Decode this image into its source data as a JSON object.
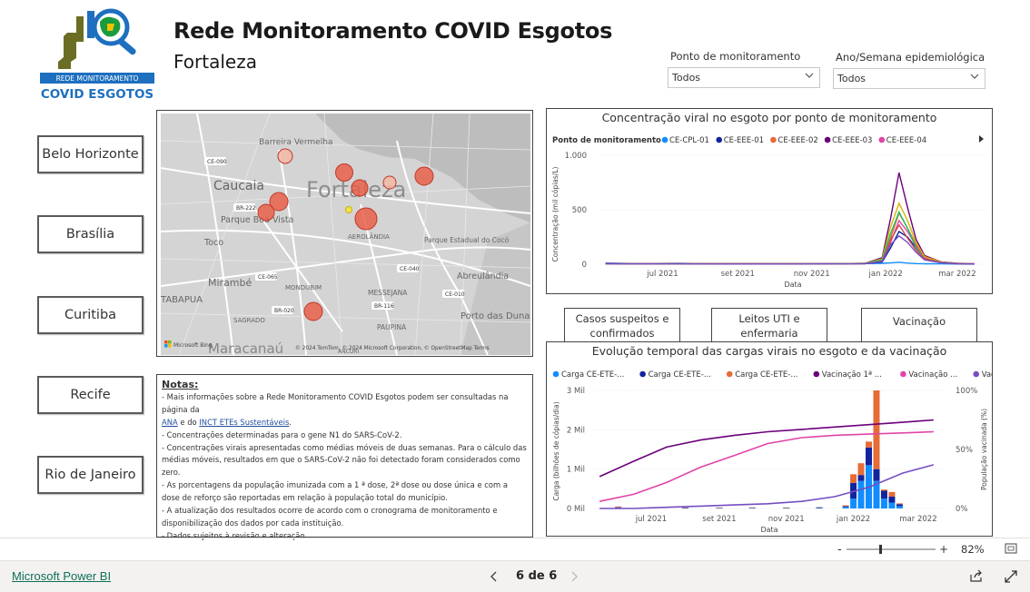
{
  "header": {
    "title": "Rede Monitoramento COVID Esgotos",
    "subtitle": "Fortaleza",
    "logo_line1": "REDE MONITORAMENTO",
    "logo_line2": "COVID ESGOTOS"
  },
  "filters": {
    "ponto": {
      "label": "Ponto de monitoramento",
      "value": "Todos"
    },
    "semana": {
      "label": "Ano/Semana epidemiológica",
      "value": "Todos"
    }
  },
  "cities": [
    "Belo Horizonte",
    "Brasília",
    "Curitiba",
    "Recife",
    "Rio de Janeiro"
  ],
  "map": {
    "labels": {
      "barreira": "Barreira Vermelha",
      "caucaia": "Caucaia",
      "fortaleza": "Fortaleza",
      "parque": "Parque Boa Vista",
      "toco": "Toco",
      "mirambe": "Mirambé",
      "maracanau": "Maracanaú",
      "aerolandia": "AEROLÂNDIA",
      "parque_estadual": "Parque Estadual do Cocó",
      "abreulandia": "Abreulândia",
      "porto": "Porto das Dunas",
      "messejana": "MESSEJANA",
      "paupina": "PAUPINA",
      "mondubim": "MONDUBIM",
      "sagrado": "SAGRADO",
      "tabapua": "TABAPUA",
      "ancuri": "ANCURI"
    },
    "roads": [
      "CE-090",
      "BR-222",
      "CE-065",
      "BR-020",
      "CE-040",
      "CE-010",
      "BR-116"
    ],
    "attribution": "© 2024 TomTom, © 2024 Microsoft Corporation, © OpenStreetMap  Terms",
    "ms_logo": "Microsoft Bing"
  },
  "notes": {
    "title": "Notas:",
    "l1a": "- Mais informações sobre a Rede Monitoramento COVID Esgotos podem ser consultadas na página da",
    "l1b_pre": "",
    "l1b_link1": "ANA",
    "l1b_mid": " e do ",
    "l1b_link2": "INCT ETEs Sustentáveis",
    "l1b_post": ".",
    "l2": "- Concentrações determinadas para o gene N1 do SARS-CoV-2.",
    "l3": "- Concentrações virais apresentadas como médias móveis de duas semanas. Para o cálculo das médias móveis, resultados em que o SARS-CoV-2 não foi detectado foram considerados como zero.",
    "l4": "- As porcentagens da população imunizada com a 1 ª dose, 2ª dose ou dose única e com a dose de reforço são reportadas em relação à população total do município.",
    "l5": "- A atualização dos resultados ocorre de acordo com o cronograma de monitoramento e disponibilização dos dados por cada instituição.",
    "l6": "- Dados sujeitos à revisão e alteração."
  },
  "chart1": {
    "title": "Concentração viral no esgoto por ponto de monitoramento",
    "legend_title": "Ponto de monitoramento",
    "ylabel": "Concentração (mil cópias/L)",
    "xlabel": "Data",
    "yticks": [
      "1.000",
      "500",
      "0"
    ],
    "xticks": [
      "jul 2021",
      "set 2021",
      "nov 2021",
      "jan 2022",
      "mar 2022"
    ]
  },
  "tabs": {
    "casos": "Casos suspeitos e confirmados",
    "leitos": "Leitos UTI e enfermaria",
    "vacinacao": "Vacinação"
  },
  "chart2": {
    "title": "Evolução temporal das cargas virais no esgoto e da vacinação",
    "ylabel": "Carga (bilhões de cópias/dia)",
    "y2label": "População vacinada (%)",
    "xlabel": "Data",
    "yticks": [
      "3 Mil",
      "2 Mil",
      "1 Mil",
      "0 Mil"
    ],
    "y2ticks": [
      "100%",
      "50%",
      "0%"
    ],
    "xticks": [
      "jul 2021",
      "set 2021",
      "nov 2021",
      "jan 2022",
      "mar 2022"
    ]
  },
  "chart_data": [
    {
      "type": "line",
      "title": "Concentração viral no esgoto por ponto de monitoramento",
      "xlabel": "Data",
      "ylabel": "Concentração (mil cópias/L)",
      "ylim": [
        0,
        1000
      ],
      "legend_placement": "top",
      "x": [
        "2021-05-15",
        "2021-06-15",
        "2021-07-15",
        "2021-08-15",
        "2021-09-15",
        "2021-10-15",
        "2021-11-15",
        "2021-12-15",
        "2021-12-29",
        "2022-01-05",
        "2022-01-12",
        "2022-01-19",
        "2022-01-26",
        "2022-02-02",
        "2022-02-16",
        "2022-03-01",
        "2022-03-15"
      ],
      "series": [
        {
          "name": "CE-CPL-01",
          "color": "#118dff",
          "values": [
            10,
            6,
            8,
            4,
            5,
            4,
            5,
            6,
            8,
            12,
            18,
            10,
            6,
            4,
            3,
            2,
            1
          ]
        },
        {
          "name": "CE-EEE-01",
          "color": "#12239e",
          "values": [
            8,
            5,
            6,
            4,
            4,
            3,
            4,
            5,
            20,
            150,
            300,
            250,
            150,
            60,
            20,
            8,
            4
          ]
        },
        {
          "name": "CE-EEE-02",
          "color": "#e66c37",
          "values": [
            6,
            4,
            5,
            3,
            3,
            3,
            3,
            6,
            40,
            240,
            470,
            330,
            180,
            70,
            20,
            8,
            3
          ]
        },
        {
          "name": "CE-EEE-03",
          "color": "#6b007b",
          "values": [
            5,
            4,
            4,
            3,
            3,
            3,
            3,
            8,
            60,
            420,
            840,
            520,
            230,
            80,
            20,
            6,
            2
          ]
        },
        {
          "name": "CE-EEE-04",
          "color": "#e044a7",
          "values": [
            6,
            4,
            5,
            3,
            3,
            3,
            4,
            6,
            30,
            200,
            400,
            300,
            170,
            60,
            18,
            6,
            3
          ]
        },
        {
          "color": "#d9b300",
          "values": [
            5,
            3,
            4,
            3,
            3,
            3,
            3,
            7,
            50,
            340,
            560,
            400,
            200,
            70,
            18,
            6,
            2
          ]
        },
        {
          "color": "#15c46b",
          "values": [
            5,
            3,
            4,
            3,
            3,
            3,
            3,
            6,
            40,
            280,
            480,
            330,
            150,
            50,
            15,
            5,
            2
          ]
        },
        {
          "color": "#d64550",
          "values": [
            5,
            3,
            4,
            3,
            3,
            3,
            3,
            5,
            30,
            220,
            360,
            240,
            130,
            50,
            15,
            5,
            2
          ]
        },
        {
          "color": "#744ec2",
          "values": [
            4,
            3,
            3,
            2,
            2,
            2,
            3,
            5,
            25,
            180,
            260,
            200,
            110,
            40,
            12,
            4,
            2
          ]
        }
      ]
    },
    {
      "type": "bar",
      "title": "Evolução temporal das cargas virais no esgoto e da vacinação",
      "xlabel": "Data",
      "ylabel": "Carga (bilhões de cópias/dia)",
      "y2label": "População vacinada (%)",
      "ylim": [
        0,
        3000
      ],
      "y2lim": [
        0,
        100
      ],
      "legend_placement": "top",
      "bar_x": [
        "2021-06-01",
        "2021-07-01",
        "2021-08-01",
        "2021-09-01",
        "2021-10-01",
        "2021-11-01",
        "2021-12-01",
        "2021-12-25",
        "2022-01-01",
        "2022-01-08",
        "2022-01-15",
        "2022-01-22",
        "2022-01-29",
        "2022-02-05",
        "2022-02-12"
      ],
      "bar_series": [
        {
          "name": "Carga CE-ETE-...",
          "color": "#118dff",
          "values": [
            20,
            15,
            10,
            10,
            12,
            10,
            15,
            40,
            250,
            700,
            1100,
            700,
            250,
            150,
            60
          ]
        },
        {
          "name": "Carga CE-ETE-...",
          "color": "#12239e",
          "values": [
            10,
            8,
            6,
            5,
            6,
            6,
            8,
            20,
            400,
            150,
            450,
            300,
            200,
            150,
            50
          ]
        },
        {
          "name": "Carga CE-ETE-...",
          "color": "#e66c37",
          "values": [
            20,
            10,
            8,
            6,
            8,
            6,
            10,
            20,
            220,
            300,
            150,
            2000,
            30,
            120,
            20
          ]
        }
      ],
      "line_x": [
        "2021-05-15",
        "2021-06-15",
        "2021-07-15",
        "2021-08-15",
        "2021-09-15",
        "2021-10-15",
        "2021-11-15",
        "2021-12-15",
        "2022-01-15",
        "2022-02-15",
        "2022-03-15"
      ],
      "line_series": [
        {
          "name": "Vacinação 1ª ...",
          "color": "#6b007b",
          "values": [
            27,
            40,
            52,
            58,
            62,
            65,
            67,
            69,
            71,
            73,
            75
          ]
        },
        {
          "name": "Vacinação ...",
          "color": "#e044a7",
          "values": [
            6,
            12,
            22,
            35,
            45,
            55,
            60,
            62,
            63,
            64,
            65
          ]
        },
        {
          "name": "Vacinação ...",
          "color": "#744ec2",
          "values": [
            0,
            0,
            1,
            2,
            3,
            4,
            6,
            10,
            18,
            30,
            37
          ]
        }
      ]
    }
  ],
  "footer": {
    "powerbi": "Microsoft Power BI",
    "pager": "6 de 6",
    "zoom": "82%"
  }
}
